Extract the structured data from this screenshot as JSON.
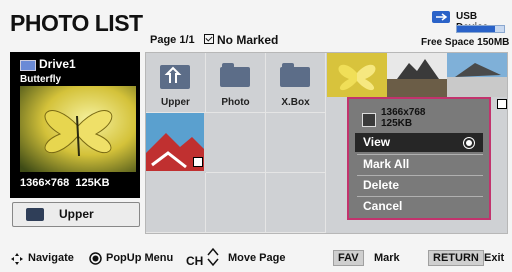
{
  "header": {
    "title": "PHOTO LIST",
    "page": "Page 1/1",
    "marked": "No Marked",
    "usb_label": "USB Device",
    "free_space": "Free Space 150MB"
  },
  "left_panel": {
    "drive": "Drive1",
    "file_name": "Butterfly",
    "resolution": "1366×768",
    "size": "125KB",
    "upper_button": "Upper"
  },
  "grid": {
    "folders": [
      {
        "label": "Upper",
        "icon": "folder-up-icon"
      },
      {
        "label": "Photo",
        "icon": "folder-icon"
      },
      {
        "label": "X.Box",
        "icon": "folder-icon"
      }
    ]
  },
  "popup": {
    "resolution": "1366x768",
    "size": "125KB",
    "items": [
      "View",
      "Mark All",
      "Delete",
      "Cancel"
    ],
    "selected": "View"
  },
  "footer": {
    "navigate": "Navigate",
    "popup_menu": "PopUp Menu",
    "ch": "CH",
    "move_page": "Move Page",
    "fav_key": "FAV",
    "mark": "Mark",
    "return_key": "RETURN",
    "exit": "Exit"
  },
  "colors": {
    "accent": "#c2336d",
    "usb": "#2a62c8",
    "panel": "#000000"
  }
}
